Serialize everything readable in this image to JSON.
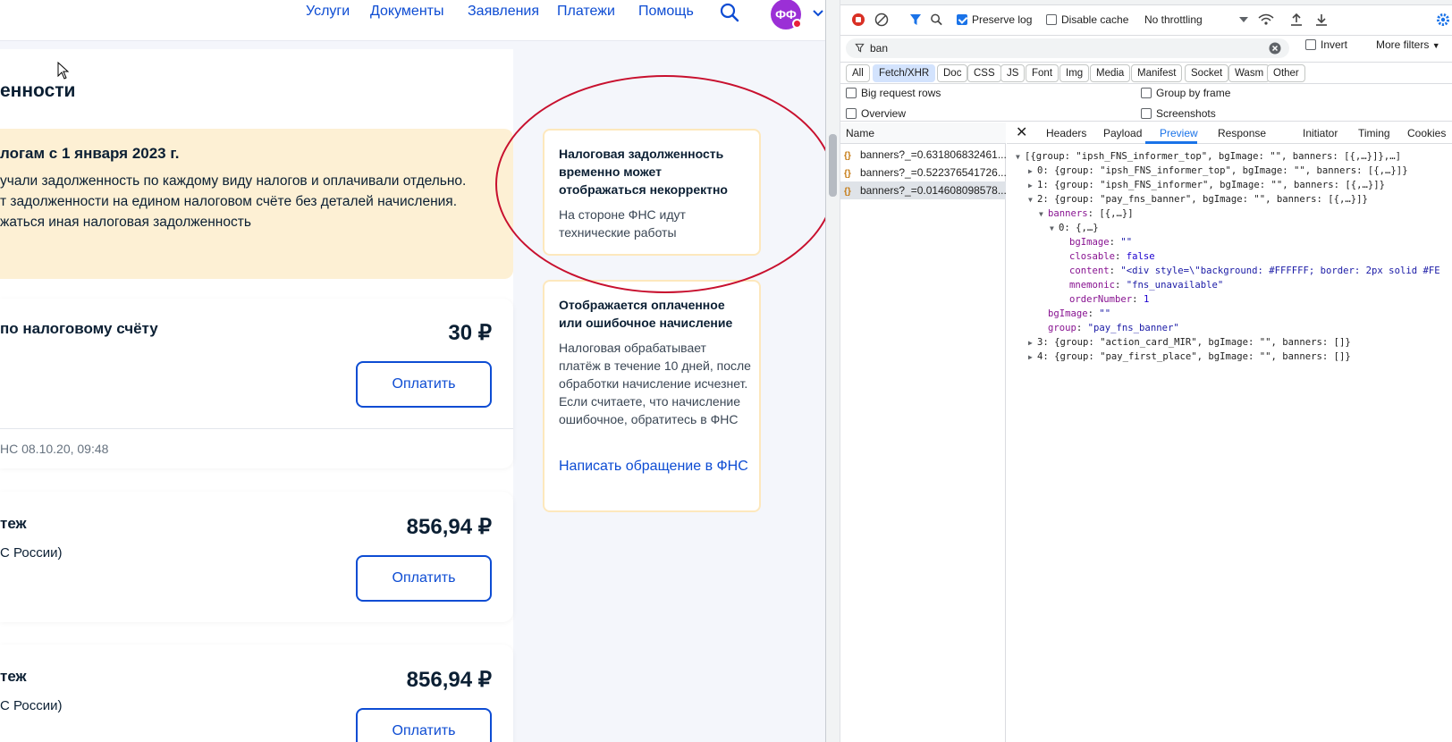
{
  "nav": {
    "links": [
      "Услуги",
      "Документы",
      "Заявления",
      "Платежи",
      "Помощь"
    ],
    "avatar_initials": "ФФ"
  },
  "main": {
    "page_title": "енности",
    "notice": {
      "title": "логам с 1 января 2023 г.",
      "lines": [
        "учали задолженность по каждому виду налогов и оплачивали отдельно.",
        "т задолженности на едином налоговом счёте без деталей начисления.",
        "жаться иная налоговая задолженность"
      ]
    },
    "payments": [
      {
        "title": "по налоговому счёту",
        "amount": "30 ₽",
        "button": "Оплатить",
        "meta": "НС  08.10.20, 09:48"
      },
      {
        "title": "теж",
        "subtitle": "С России)",
        "amount": "856,94 ₽",
        "button": "Оплатить"
      },
      {
        "title": "теж",
        "subtitle": "С России)",
        "amount": "856,94 ₽",
        "button": "Оплатить"
      }
    ],
    "info_cards": [
      {
        "title": "Налоговая задолженность временно может отображаться некорректно",
        "text": "На стороне ФНС идут технические работы"
      },
      {
        "title": "Отображается оплаченное или ошибочное начисление",
        "text": "Налоговая обрабатывает платёж в течение 10 дней, после обработки начисление исчезнет. Если считаете, что начисление ошибочное, обратитесь в ФНС",
        "link": "Написать обращение в ФНС"
      }
    ]
  },
  "devtools": {
    "toolbar": {
      "preserve_log": "Preserve log",
      "disable_cache": "Disable cache",
      "throttling": "No throttling"
    },
    "filter": {
      "value": "ban",
      "invert": "Invert",
      "more_filters": "More filters"
    },
    "types": [
      "All",
      "Fetch/XHR",
      "Doc",
      "CSS",
      "JS",
      "Font",
      "Img",
      "Media",
      "Manifest",
      "Socket",
      "Wasm",
      "Other"
    ],
    "options": {
      "big_request_rows": "Big request rows",
      "group_by_frame": "Group by frame",
      "overview": "Overview",
      "screenshots": "Screenshots"
    },
    "list_header": "Name",
    "requests": [
      "banners?_=0.631806832461...",
      "banners?_=0.522376541726...",
      "banners?_=0.014608098578..."
    ],
    "detail_tabs": [
      "Headers",
      "Payload",
      "Preview",
      "Response",
      "Initiator",
      "Timing",
      "Cookies"
    ],
    "preview": {
      "l0": "[{group: \"ipsh_FNS_informer_top\", bgImage: \"\", banners: [{,…}]},…]",
      "l1": "0: {group: \"ipsh_FNS_informer_top\", bgImage: \"\", banners: [{,…}]}",
      "l2": "1: {group: \"ipsh_FNS_informer\", bgImage: \"\", banners: [{,…}]}",
      "l3": "2: {group: \"pay_fns_banner\", bgImage: \"\", banners: [{,…}]}",
      "l4_key": "banners",
      "l4_val": "[{,…}]",
      "l5": "0: {,…}",
      "f_bgimage_k": "bgImage",
      "f_bgimage_v": "\"\"",
      "f_closable_k": "closable",
      "f_closable_v": "false",
      "f_content_k": "content",
      "f_content_v": "\"<div style=\\\"background: #FFFFFF; border: 2px solid #FE",
      "f_mnemonic_k": "mnemonic",
      "f_mnemonic_v": "\"fns_unavailable\"",
      "f_order_k": "orderNumber",
      "f_order_v": "1",
      "g_bgimage_k": "bgImage",
      "g_bgimage_v": "\"\"",
      "g_group_k": "group",
      "g_group_v": "\"pay_fns_banner\"",
      "l6": "3: {group: \"action_card_MIR\", bgImage: \"\", banners: []}",
      "l7": "4: {group: \"pay_first_place\", bgImage: \"\", banners: []}"
    }
  }
}
